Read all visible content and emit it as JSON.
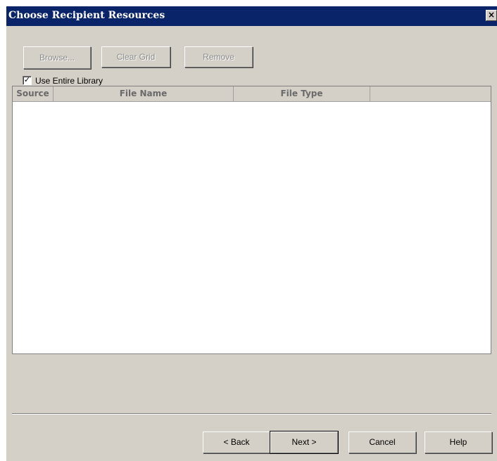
{
  "window": {
    "title": "Choose Recipient Resources",
    "close_glyph": "×"
  },
  "toolbar": {
    "browse_label": "Browse...",
    "clear_grid_label": "Clear Grid",
    "remove_label": "Remove"
  },
  "options": {
    "use_entire_library_label": "Use Entire Library",
    "use_entire_library_checked": true,
    "check_glyph": "✓"
  },
  "grid": {
    "columns": [
      "Source",
      "File Name",
      "File Type"
    ],
    "rows": []
  },
  "footer": {
    "back_label": "< Back",
    "next_label": "Next >",
    "cancel_label": "Cancel",
    "help_label": "Help"
  }
}
